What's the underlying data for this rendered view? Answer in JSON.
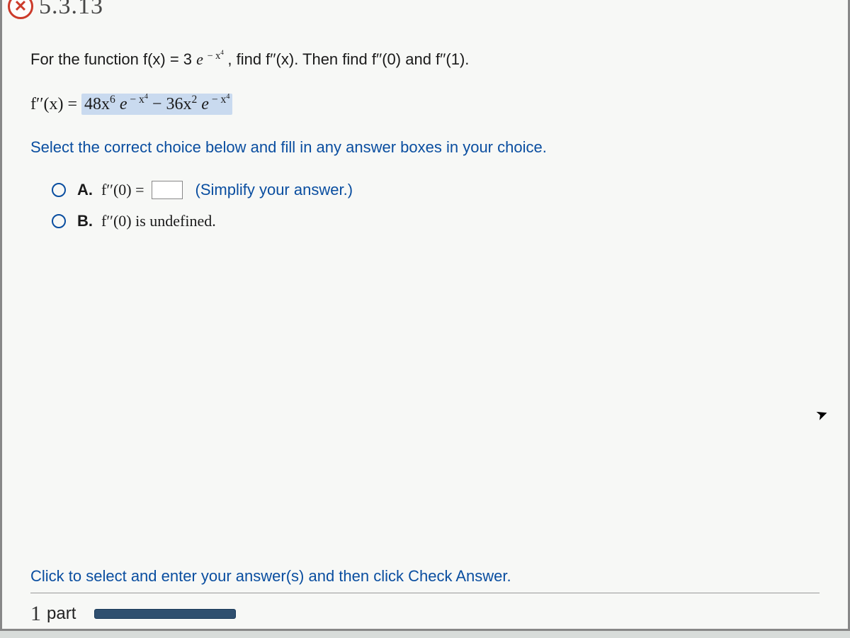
{
  "header": {
    "section_number": "5.3.13",
    "close_symbol": "✕"
  },
  "question": {
    "lead": "For the function f(x) = 3",
    "exp_base": "e",
    "exp_power": "− x",
    "exp_power_sup": "4",
    "find_text": ", find f′′(x). Then find f′′(0) and f′′(1)."
  },
  "derivative": {
    "lhs": "f′′(x) = ",
    "term1_coef": "48x",
    "term1_sup": "6",
    "term1_e": " e",
    "term1_epow": " − x",
    "term1_epow_sup": "4",
    "minus": " − 36x",
    "term2_sup": "2",
    "term2_e": " e",
    "term2_epow": " − x",
    "term2_epow_sup": "4"
  },
  "instruction": "Select the correct choice below and fill in any answer boxes in your choice.",
  "choices": {
    "a": {
      "letter": "A.",
      "text": "f′′(0) =",
      "hint": "(Simplify your answer.)"
    },
    "b": {
      "letter": "B.",
      "text": "f′′(0) is undefined."
    }
  },
  "footer": {
    "instruction": "Click to select and enter your answer(s) and then click Check Answer.",
    "parts_num": "1",
    "parts_label": "part"
  }
}
